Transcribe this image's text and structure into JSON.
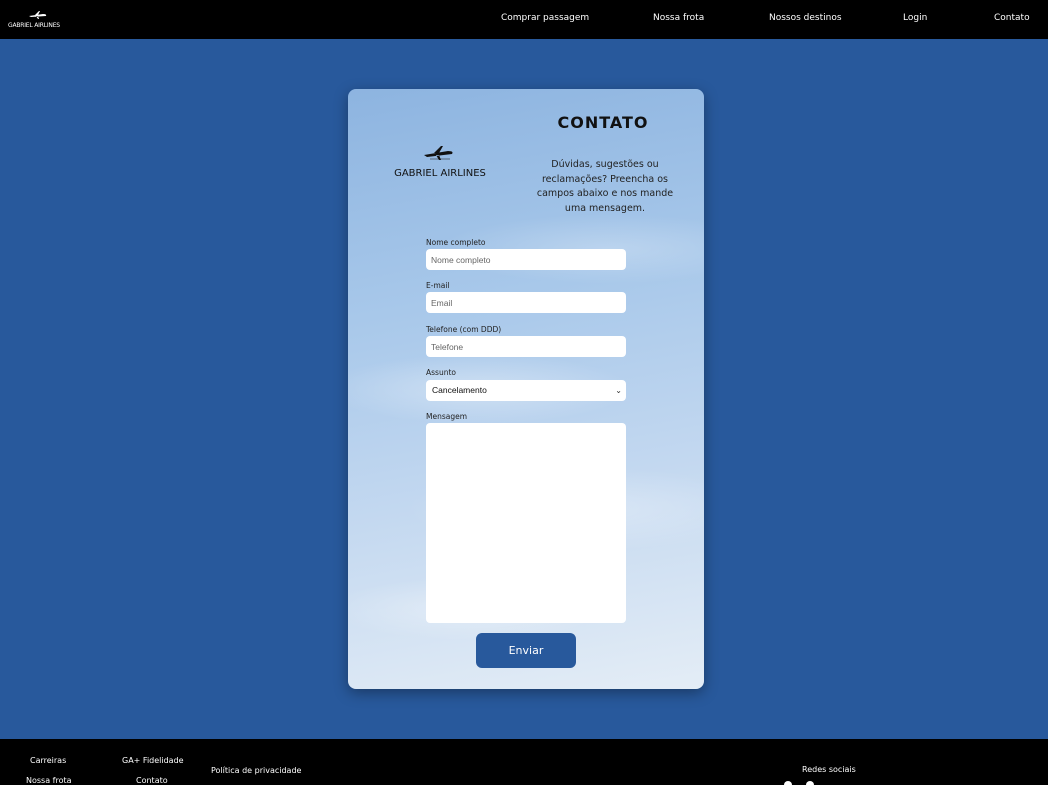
{
  "header": {
    "brand": "GABRIEL AIRLINES",
    "nav": [
      "Comprar passagem",
      "Nossa frota",
      "Nossos destinos",
      "Login",
      "Contato"
    ]
  },
  "card": {
    "title": "CONTATO",
    "logo_text": "GABRIEL AIRLINES",
    "description": "Dúvidas, sugestões ou reclamações? Preencha os campos abaixo e nos mande uma mensagem.",
    "fields": {
      "name_label": "Nome completo",
      "name_placeholder": "Nome completo",
      "email_label": "E-mail",
      "email_placeholder": "Email",
      "phone_label": "Telefone (com DDD)",
      "phone_placeholder": "Telefone",
      "subject_label": "Assunto",
      "subject_value": "Cancelamento",
      "message_label": "Mensagem"
    },
    "submit": "Enviar"
  },
  "footer": {
    "careers": "Carreiras",
    "loyalty": "GA+ Fidelidade",
    "privacy": "Política de privacidade",
    "fleet": "Nossa frota",
    "contact": "Contato",
    "social": "Redes sociais"
  },
  "colors": {
    "background": "#28599c",
    "bars": "#000000",
    "button": "#28599c"
  }
}
